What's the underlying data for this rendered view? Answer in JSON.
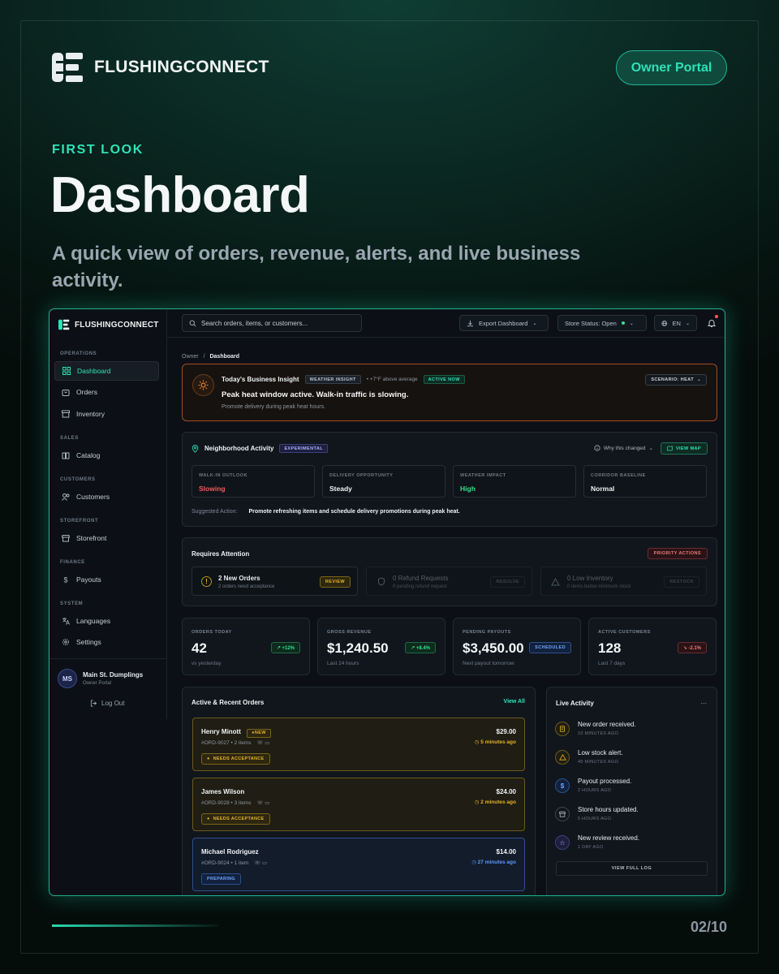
{
  "brand": {
    "name": "FLUSHINGCONNECT",
    "portal_label": "Owner Portal"
  },
  "hero": {
    "eyebrow": "FIRST LOOK",
    "title": "Dashboard",
    "subtitle": "A quick view of orders, revenue, alerts, and live business activity."
  },
  "footer": {
    "pager": "02/10"
  },
  "colors": {
    "accent": "#2ee3b8",
    "bg": "#06120f",
    "warning": "#e6b324",
    "danger": "#ef5a5a",
    "info": "#4a8bff"
  },
  "app": {
    "brand": "FLUSHINGCONNECT",
    "sidebar": {
      "sections": [
        {
          "label": "OPERATIONS"
        },
        {
          "label": "SALES"
        },
        {
          "label": "CUSTOMERS"
        },
        {
          "label": "STOREFRONT"
        },
        {
          "label": "FINANCE"
        },
        {
          "label": "SYSTEM"
        }
      ],
      "items": [
        {
          "label": "Dashboard",
          "icon": "grid-icon"
        },
        {
          "label": "Orders",
          "icon": "bag-icon"
        },
        {
          "label": "Inventory",
          "icon": "archive-icon"
        },
        {
          "label": "Catalog",
          "icon": "book-icon"
        },
        {
          "label": "Customers",
          "icon": "users-icon"
        },
        {
          "label": "Storefront",
          "icon": "store-icon"
        },
        {
          "label": "Payouts",
          "icon": "dollar-icon"
        },
        {
          "label": "Languages",
          "icon": "translate-icon"
        },
        {
          "label": "Settings",
          "icon": "gear-icon"
        }
      ],
      "user": {
        "initials": "MS",
        "name": "Main St. Dumplings",
        "role": "Owner Portal",
        "logout": "Log Out"
      }
    },
    "topbar": {
      "search_placeholder": "Search orders, items, or customers...",
      "export": "Export Dashboard",
      "store_status": "Store Status: Open",
      "language": "EN"
    },
    "breadcrumb": {
      "root": "Owner",
      "current": "Dashboard"
    },
    "insight": {
      "title": "Today's Business Insight",
      "tag": "WEATHER INSIGHT",
      "note": "• +7°F above average",
      "status": "ACTIVE NOW",
      "headline": "Peak heat window active. Walk-in traffic is slowing.",
      "detail": "Promote delivery during peak heat hours.",
      "scenario": "SCENARIO: HEAT"
    },
    "neighborhood": {
      "title": "Neighborhood Activity",
      "tag": "EXPERIMENTAL",
      "why": "Why this changed",
      "map": "VIEW MAP",
      "boxes": [
        {
          "key": "WALK-IN OUTLOOK",
          "value": "Slowing"
        },
        {
          "key": "DELIVERY OPPORTUNITY",
          "value": "Steady"
        },
        {
          "key": "WEATHER IMPACT",
          "value": "High"
        },
        {
          "key": "CORRIDOR BASELINE",
          "value": "Normal"
        }
      ],
      "suggested_label": "Suggested Action:",
      "suggested": "Promote refreshing items and schedule delivery promotions during peak heat."
    },
    "attention": {
      "title": "Requires Attention",
      "priority": "PRIORITY ACTIONS",
      "items": [
        {
          "title": "2 New Orders",
          "sub": "2 orders need acceptance",
          "action": "REVIEW"
        },
        {
          "title": "0 Refund Requests",
          "sub": "0 pending refund request",
          "action": "RESOLVE"
        },
        {
          "title": "0 Low Inventory",
          "sub": "0 items below minimum stock",
          "action": "RESTOCK"
        }
      ]
    },
    "stats": [
      {
        "key": "ORDERS TODAY",
        "value": "42",
        "sub": "vs yesterday",
        "badge": "↗ +12%"
      },
      {
        "key": "GROSS REVENUE",
        "value": "$1,240.50",
        "sub": "Last 24 hours",
        "badge": "↗ +8.4%"
      },
      {
        "key": "PENDING PAYOUTS",
        "value": "$3,450.00",
        "sub": "Next payout tomorrow",
        "badge": "SCHEDULED"
      },
      {
        "key": "ACTIVE CUSTOMERS",
        "value": "128",
        "sub": "Last 7 days",
        "badge": "↘ -2.1%"
      }
    ],
    "orders": {
      "title": "Active & Recent Orders",
      "view_all": "View All",
      "rows": [
        {
          "name": "Henry Minott",
          "new": "NEW",
          "id": "#ORD-9027 • 2 items",
          "amount": "$29.00",
          "time": "5 minutes ago",
          "status": "NEEDS ACCEPTANCE"
        },
        {
          "name": "James Wilson",
          "id": "#ORD-9028 • 3 items",
          "amount": "$24.00",
          "time": "2 minutes ago",
          "status": "NEEDS ACCEPTANCE"
        },
        {
          "name": "Michael Rodriguez",
          "id": "#ORD-9024 • 1 item",
          "amount": "$14.00",
          "time": "27 minutes ago",
          "status": "PREPARING"
        }
      ]
    },
    "live": {
      "title": "Live Activity",
      "more": "...",
      "items": [
        {
          "text": "New order received.",
          "time": "10 MINUTES AGO"
        },
        {
          "text": "Low stock alert.",
          "time": "45 MINUTES AGO"
        },
        {
          "text": "Payout processed.",
          "time": "2 HOURS AGO"
        },
        {
          "text": "Store hours updated.",
          "time": "5 HOURS AGO"
        },
        {
          "text": "New review received.",
          "time": "1 DAY AGO"
        }
      ],
      "full_log": "VIEW FULL LOG"
    }
  }
}
